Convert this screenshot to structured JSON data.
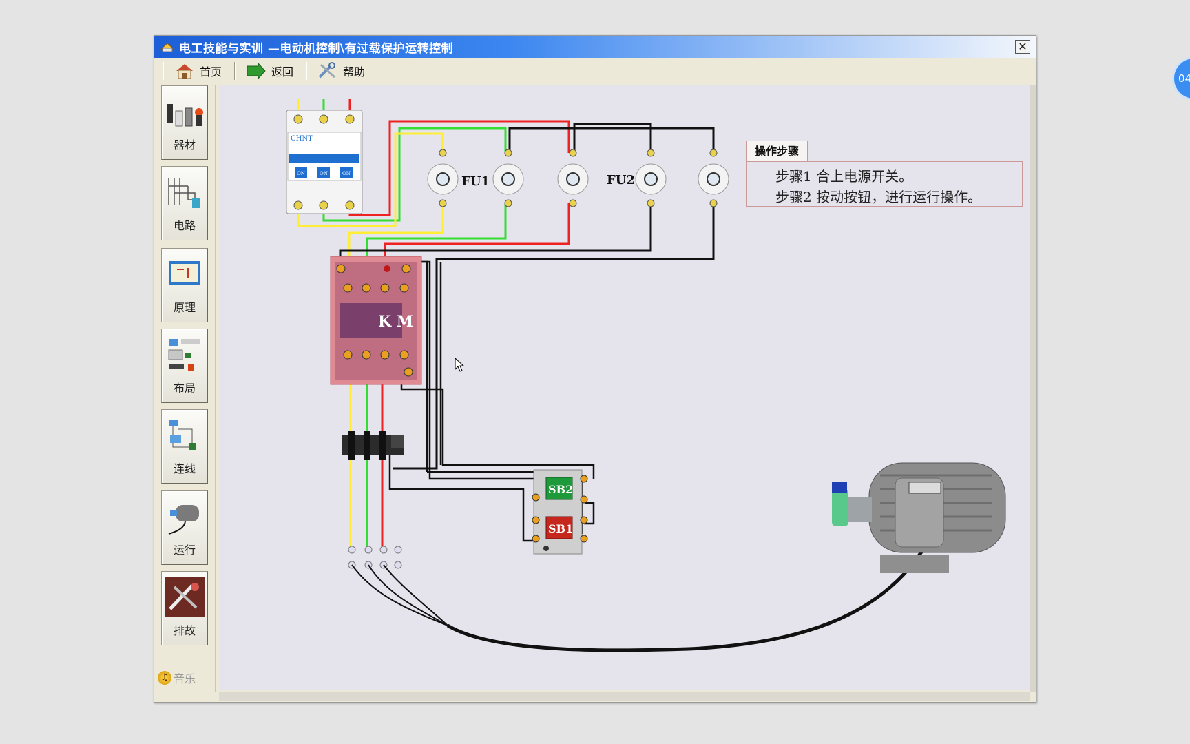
{
  "window": {
    "title": "电工技能与实训 —电动机控制\\有过载保护运转控制",
    "close_label": "✕"
  },
  "toolbar": {
    "home_label": "首页",
    "back_label": "返回",
    "help_label": "帮助"
  },
  "sidebar": {
    "items": [
      {
        "label": "器材",
        "icon": "equipment-icon"
      },
      {
        "label": "电路",
        "icon": "circuit-icon"
      },
      {
        "label": "原理",
        "icon": "principle-icon"
      },
      {
        "label": "布局",
        "icon": "layout-icon"
      },
      {
        "label": "连线",
        "icon": "wiring-icon"
      },
      {
        "label": "运行",
        "icon": "run-motor-icon"
      },
      {
        "label": "排故",
        "icon": "troubleshoot-icon"
      }
    ],
    "music_label": "音乐"
  },
  "diagram": {
    "fuse1_label": "FU1",
    "fuse2_label": "FU2",
    "contactor_label": "K M",
    "stop_button_label": "SB1",
    "start_button_label": "SB2",
    "breaker_brand": "CHNT",
    "breaker_on_label": "ON"
  },
  "steps_panel": {
    "tab_label": "操作步骤",
    "step1": "步骤1  合上电源开关。",
    "step2": "步骤2  按动按钮，进行运行操作。"
  },
  "side_badge": "04",
  "colors": {
    "wire_yellow": "#ffee33",
    "wire_green": "#33dd33",
    "wire_red": "#ee2222",
    "wire_black": "#111111",
    "contactor": "#e08a94",
    "start_button": "#1f9a3a",
    "stop_button": "#c6261c"
  }
}
